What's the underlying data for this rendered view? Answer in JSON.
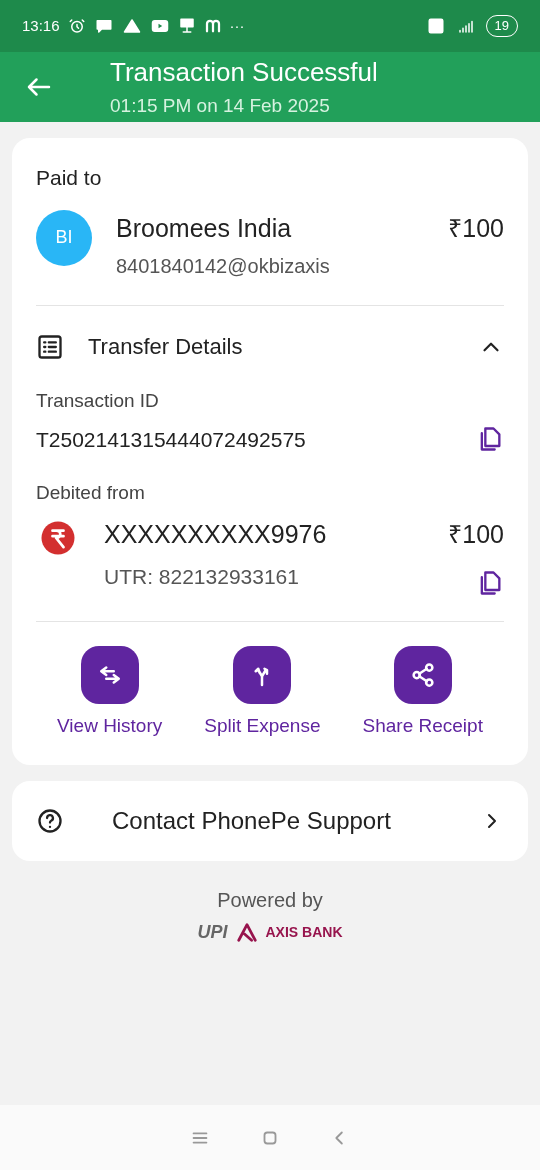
{
  "status_bar": {
    "time": "13:16",
    "more": "···",
    "battery": "19"
  },
  "header": {
    "title": "Transaction Successful",
    "subtitle": "01:15 PM on 14 Feb 2025"
  },
  "paid_to": {
    "label": "Paid to",
    "initials": "BI",
    "name": "Broomees India",
    "upi_id": "8401840142@okbizaxis",
    "amount": "₹100"
  },
  "transfer_details": {
    "title": "Transfer Details",
    "expanded": true,
    "transaction_id_label": "Transaction ID",
    "transaction_id": "T2502141315444072492575",
    "debited_label": "Debited from",
    "account": "XXXXXXXXXX9976",
    "amount": "₹100",
    "utr": "UTR: 822132933161"
  },
  "actions": [
    {
      "kind": "history",
      "label": "View History"
    },
    {
      "kind": "split",
      "label": "Split Expense"
    },
    {
      "kind": "share",
      "label": "Share Receipt"
    }
  ],
  "support": {
    "label": "Contact PhonePe Support"
  },
  "footer": {
    "powered_by": "Powered by",
    "upi": "UPI",
    "bank": "AXIS BANK"
  }
}
